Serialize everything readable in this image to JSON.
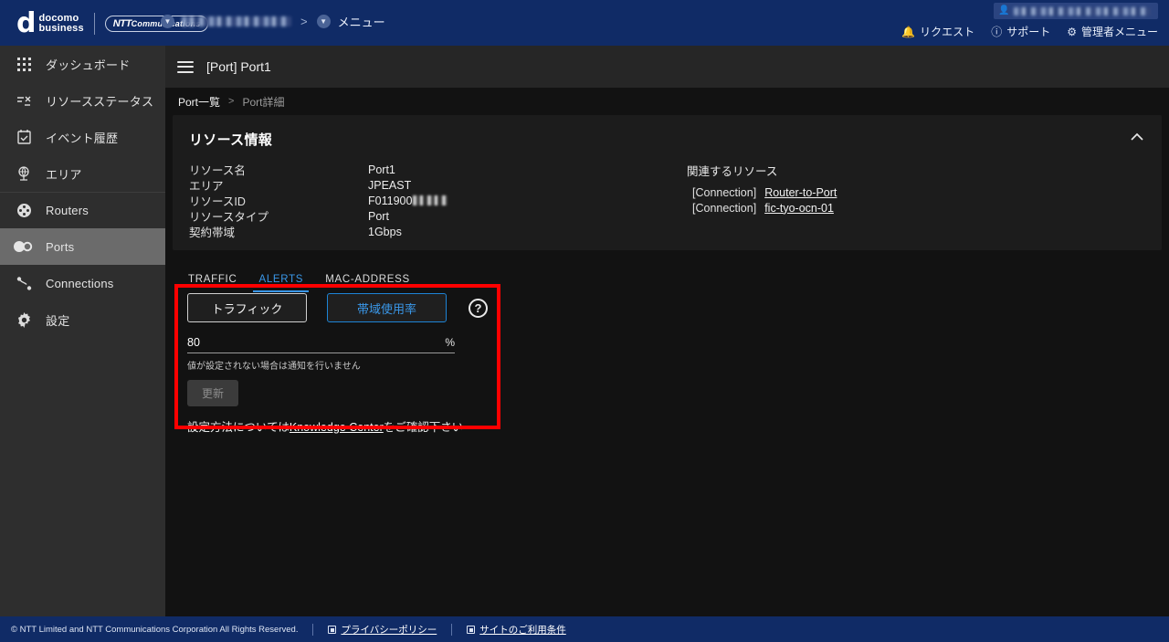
{
  "topbar": {
    "brand_mark": "d",
    "brand_line1": "docomo",
    "brand_line2": "business",
    "partner_logo": "NTT Communications",
    "org_selector_label": "",
    "nav_separator": ">",
    "menu_label": "メニュー",
    "user_badge_label": "",
    "links": [
      {
        "icon": "bell-icon",
        "glyph": "♟",
        "label": "リクエスト"
      },
      {
        "icon": "question-circle-icon",
        "glyph": "?",
        "label": "サポート"
      },
      {
        "icon": "gear-icon",
        "glyph": "⚙",
        "label": "管理者メニュー"
      }
    ]
  },
  "sidebar": {
    "items": [
      {
        "label": "ダッシュボード",
        "icon": "grid-dashboard-icon",
        "selected": false,
        "divider": false
      },
      {
        "label": "リソースステータス",
        "icon": "resource-status-icon",
        "selected": false,
        "divider": false
      },
      {
        "label": "イベント履歴",
        "icon": "calendar-check-icon",
        "selected": false,
        "divider": false
      },
      {
        "label": "エリア",
        "icon": "globe-area-icon",
        "selected": false,
        "divider": false
      },
      {
        "label": "Routers",
        "icon": "router-icon",
        "selected": false,
        "divider": true
      },
      {
        "label": "Ports",
        "icon": "ports-icon",
        "selected": true,
        "divider": false
      },
      {
        "label": "Connections",
        "icon": "connections-icon",
        "selected": false,
        "divider": false
      },
      {
        "label": "設定",
        "icon": "gear-icon",
        "selected": false,
        "divider": false
      }
    ]
  },
  "page": {
    "title": "[Port] Port1",
    "breadcrumb": {
      "parent": "Port一覧",
      "separator": ">",
      "current": "Port詳細"
    }
  },
  "resource_panel": {
    "title": "リソース情報",
    "collapse_glyph": "ⱏ",
    "fields": [
      {
        "key": "リソース名",
        "value": "Port1",
        "masked": false
      },
      {
        "key": "エリア",
        "value": "JPEAST",
        "masked": false
      },
      {
        "key": "リソースID",
        "value": "F011900",
        "masked": true
      },
      {
        "key": "リソースタイプ",
        "value": "Port",
        "masked": false
      },
      {
        "key": "契約帯域",
        "value": "1Gbps",
        "masked": false
      }
    ],
    "related": {
      "title": "関連するリソース",
      "items": [
        {
          "type": "[Connection]",
          "name": "Router-to-Port"
        },
        {
          "type": "[Connection]",
          "name": "fic-tyo-ocn-01"
        }
      ]
    }
  },
  "tabs": [
    {
      "label": "TRAFFIC",
      "active": false
    },
    {
      "label": "ALERTS",
      "active": true
    },
    {
      "label": "MAC-ADDRESS",
      "active": false
    }
  ],
  "alerts": {
    "metric_buttons": [
      {
        "label": "トラフィック",
        "selected": false
      },
      {
        "label": "帯域使用率",
        "selected": true
      }
    ],
    "help_glyph": "?",
    "threshold_value": "80",
    "threshold_placeholder": "",
    "threshold_suffix": "%",
    "helper_text": "値が設定されない場合は通知を行いません",
    "update_button": "更新",
    "kc_prefix": "設定方法については",
    "kc_link": "Knowledge Center",
    "kc_suffix": "をご確認下さい"
  },
  "footer": {
    "copyright": "© NTT Limited and NTT Communications Corporation All Rights Reserved.",
    "links": [
      {
        "label": "プライバシーポリシー"
      },
      {
        "label": "サイトのご利用条件"
      }
    ]
  },
  "colors": {
    "brand_blue": "#102b66",
    "accent_blue": "#3a97e8",
    "sidebar_bg": "#2e2e2e",
    "selected_item": "#6b6b6b",
    "panel_bg": "#1c1c1c",
    "page_bg": "#121212",
    "highlight_box": "#ff0000"
  }
}
